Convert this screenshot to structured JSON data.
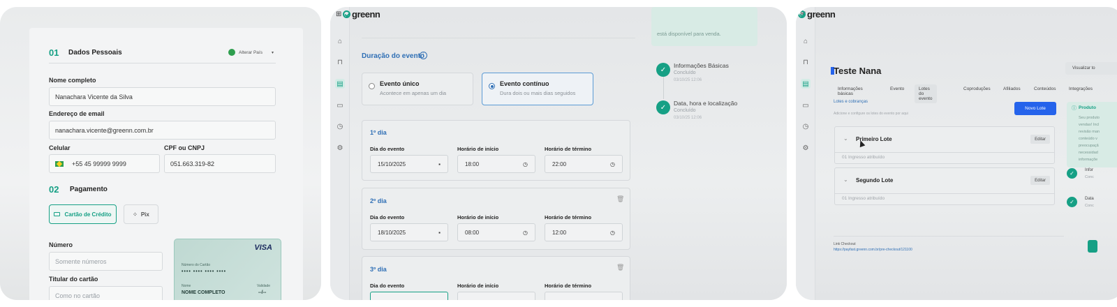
{
  "panel1": {
    "section1": {
      "num": "01",
      "title": "Dados Pessoais",
      "country_btn": "Alterar País"
    },
    "name_label": "Nome completo",
    "name_value": "Nanachara Vicente da Silva",
    "email_label": "Endereço de email",
    "email_value": "nanachara.vicente@greenn.com.br",
    "phone_label": "Celular",
    "phone_value": "+55 45 99999 9999",
    "cpf_label": "CPF ou CNPJ",
    "cpf_value": "051.663.319-82",
    "section2": {
      "num": "02",
      "title": "Pagamento"
    },
    "pay_card": "Cartão de Crédito",
    "pay_pix": "Pix",
    "number_label": "Número",
    "number_placeholder": "Somente números",
    "holder_label": "Titular do cartão",
    "holder_placeholder": "Como no cartão",
    "card_preview": {
      "brand": "VISA",
      "number_label": "Número do Cartão",
      "number": "•••• •••• •••• ••••",
      "name_label": "Nome",
      "name": "NOME COMPLETO",
      "validity_label": "Validade",
      "validity": "--/--"
    }
  },
  "panel2": {
    "logo": "greenn",
    "notice": "está disponível para venda.",
    "duration_title": "Duração do evento",
    "opt_single": {
      "title": "Evento único",
      "sub": "Acontece em apenas um dia"
    },
    "opt_continuous": {
      "title": "Evento contínuo",
      "sub": "Dura dois ou mais dias seguidos"
    },
    "labels": {
      "date": "Dia do evento",
      "start": "Horário de início",
      "end": "Horário de término"
    },
    "days": [
      {
        "title": "1º dia",
        "date": "15/10/2025",
        "start": "18:00",
        "end": "22:00"
      },
      {
        "title": "2º dia",
        "date": "18/10/2025",
        "start": "08:00",
        "end": "12:00"
      },
      {
        "title": "3º dia"
      }
    ],
    "steps": [
      {
        "title": "Informações Básicas",
        "status": "Concluído",
        "date": "03/10/25 12:06"
      },
      {
        "title": "Data, hora e localização",
        "status": "Concluído",
        "date": "03/10/25 12:06"
      }
    ]
  },
  "panel3": {
    "logo": "greenn",
    "title": "Teste Nana",
    "visualize_btn": "Visualizar to",
    "tabs": [
      "Informações básicas",
      "Evento",
      "Lotes do evento",
      "Coproduções",
      "Afiliados",
      "Conteúdos",
      "Integrações"
    ],
    "active_tab": "Lotes do evento",
    "section_link": "Lotes e cobranças",
    "section_sub": "Adicione e configure os lotes do evento por aqui",
    "new_btn": "Novo Lote",
    "lotes": [
      {
        "name": "Primeiro Lote",
        "edit": "Editar",
        "sub": "01  Ingresso atribuído"
      },
      {
        "name": "Segundo Lote",
        "edit": "Editar",
        "sub": "01  Ingresso atribuído"
      }
    ],
    "checkout_label": "Link Checkout",
    "checkout_url": "https://payfast.greenn.com.br/pre-checkout/121100",
    "side_card_title": "Produto",
    "side_card_lines": [
      "Seu produto",
      "vendas! Incl",
      "revisão man",
      "conteúdo v",
      "preocupaçã",
      "necessidad",
      "informaçõe"
    ],
    "side_steps": [
      {
        "title": "Infor",
        "sub": "Conc"
      },
      {
        "title": "Data",
        "sub": "Conc"
      }
    ]
  }
}
